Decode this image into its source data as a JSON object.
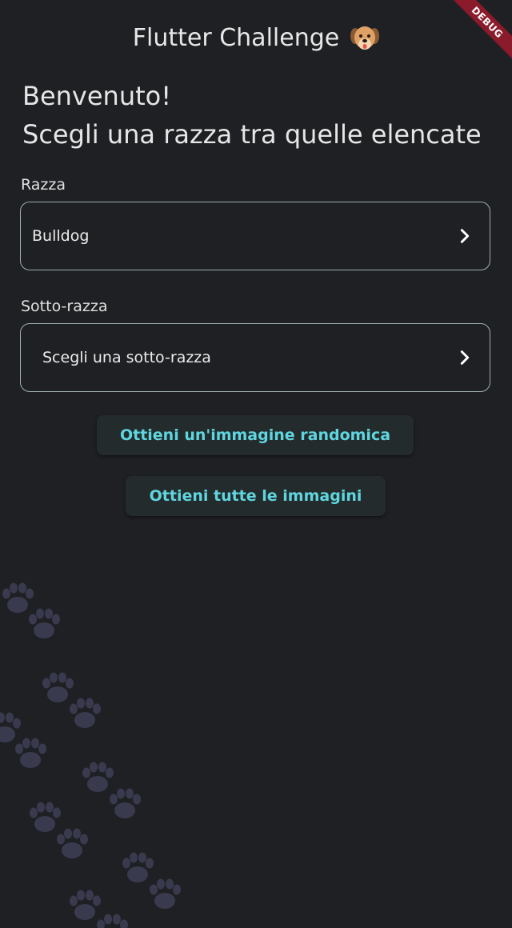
{
  "appbar": {
    "title": "Flutter Challenge",
    "icon": "dog-face-icon"
  },
  "debug_banner": "DEBUG",
  "welcome": {
    "line1": "Benvenuto!",
    "line2": "Scegli una razza tra quelle elencate"
  },
  "breed": {
    "label": "Razza",
    "value": "Bulldog"
  },
  "sub_breed": {
    "label": "Sotto-razza",
    "value": "Scegli una sotto-razza"
  },
  "buttons": {
    "random_image": "Ottieni un'immagine randomica",
    "all_images": "Ottieni tutte le immagini"
  },
  "colors": {
    "background": "#1f2023",
    "field_border": "#9eb1aa",
    "button_text": "#5fd6df",
    "button_bg": "#242b2c",
    "paw_color": "#3a3a4f",
    "debug_ribbon": "#8b1a2a"
  }
}
